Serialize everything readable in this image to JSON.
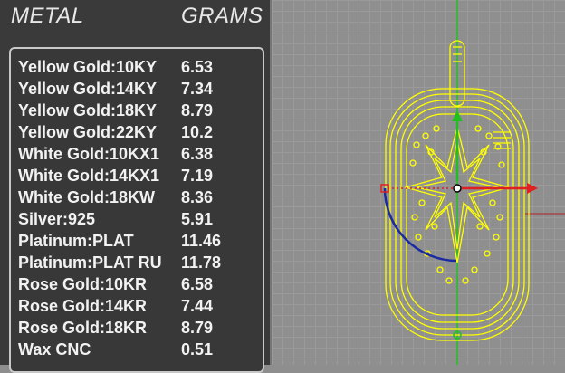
{
  "panel": {
    "header_metal": "METAL",
    "header_grams": "GRAMS",
    "rows": [
      {
        "metal": "Yellow Gold:10KY",
        "grams": "6.53"
      },
      {
        "metal": "Yellow Gold:14KY",
        "grams": "7.34"
      },
      {
        "metal": "Yellow Gold:18KY",
        "grams": "8.79"
      },
      {
        "metal": "Yellow Gold:22KY",
        "grams": "10.2"
      },
      {
        "metal": "White Gold:10KX1",
        "grams": "6.38"
      },
      {
        "metal": "White Gold:14KX1",
        "grams": "7.19"
      },
      {
        "metal": "White Gold:18KW",
        "grams": "8.36"
      },
      {
        "metal": "Silver:925",
        "grams": "5.91"
      },
      {
        "metal": "Platinum:PLAT",
        "grams": "11.46"
      },
      {
        "metal": "Platinum:PLAT RU",
        "grams": "11.78"
      },
      {
        "metal": "Rose Gold:10KR",
        "grams": "6.58"
      },
      {
        "metal": "Rose Gold:14KR",
        "grams": "7.44"
      },
      {
        "metal": "Rose Gold:18KR",
        "grams": "8.79"
      },
      {
        "metal": "Wax  CNC",
        "grams": "0.51"
      }
    ]
  },
  "colors": {
    "wireframe": "#ffff00",
    "axis_x": "#e02020",
    "axis_y": "#20c020",
    "rotation_arc": "#1a2aa0",
    "panel_bg": "#3a3a3a",
    "viewport_bg": "#8f8f8f"
  }
}
